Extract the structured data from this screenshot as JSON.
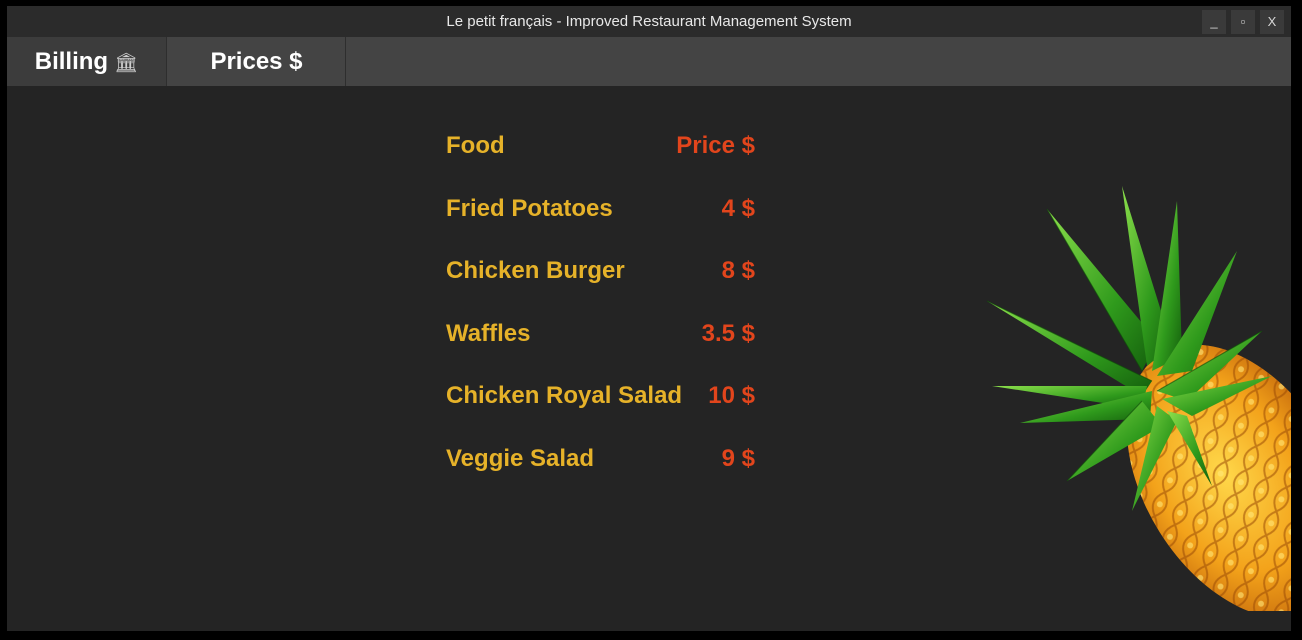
{
  "window": {
    "title": "Le petit français - Improved Restaurant Management System",
    "controls": {
      "minimize": "_",
      "maximize": "▫",
      "close": "X"
    }
  },
  "tabs": [
    {
      "label": "Billing",
      "icon": "bank-icon",
      "icon_glyph": "🏛"
    },
    {
      "label": "Prices $"
    }
  ],
  "menu": {
    "header": {
      "food": "Food",
      "price": "Price $"
    },
    "items": [
      {
        "food": "Fried Potatoes",
        "price": "4 $"
      },
      {
        "food": "Chicken Burger",
        "price": "8 $"
      },
      {
        "food": "Waffles",
        "price": "3.5 $"
      },
      {
        "food": "Chicken Royal Salad",
        "price": "10 $"
      },
      {
        "food": "Veggie Salad",
        "price": "9 $"
      }
    ]
  },
  "colors": {
    "background": "#242424",
    "food_text": "#e6b229",
    "price_text": "#e2451c",
    "tab_bar": "#444444"
  },
  "decoration": {
    "image": "pineapple-image"
  }
}
